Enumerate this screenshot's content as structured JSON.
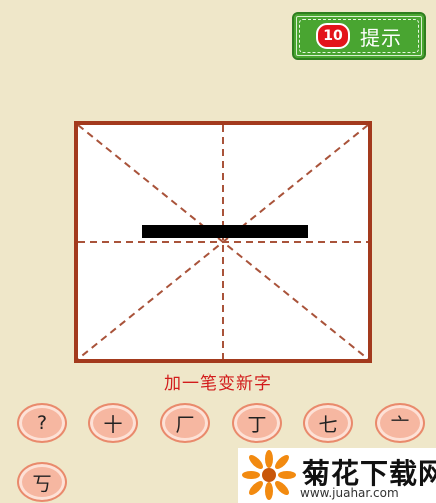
{
  "hint": {
    "count": "10",
    "label": "提示"
  },
  "board": {
    "character": "一"
  },
  "prompt": "加一笔变新字",
  "options": [
    "?",
    "十",
    "厂",
    "丁",
    "七",
    "亠",
    "丂"
  ],
  "watermark": {
    "title": "菊花下载网",
    "url": "www.juahar.com"
  },
  "colors": {
    "background": "#efe7c9",
    "hint_green": "#49a531",
    "board_border": "#a33a1d",
    "prompt_red": "#d21c1c",
    "option_fill": "#f6b7a1"
  }
}
